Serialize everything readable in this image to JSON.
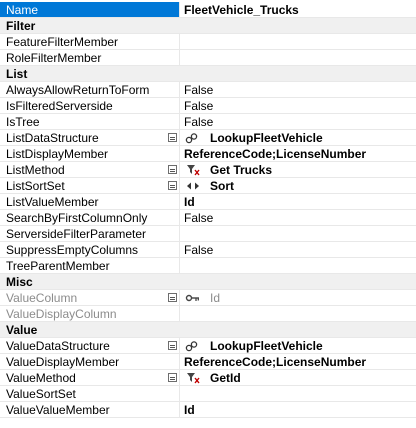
{
  "rows": [
    {
      "kind": "prop",
      "label": "Name",
      "value": "FleetVehicle_Trucks",
      "bold": true,
      "selected": true
    },
    {
      "kind": "cat",
      "label": "Filter"
    },
    {
      "kind": "prop",
      "label": "FeatureFilterMember",
      "value": ""
    },
    {
      "kind": "prop",
      "label": "RoleFilterMember",
      "value": ""
    },
    {
      "kind": "cat",
      "label": "List"
    },
    {
      "kind": "prop",
      "label": "AlwaysAllowReturnToForm",
      "value": "False"
    },
    {
      "kind": "prop",
      "label": "IsFilteredServerside",
      "value": "False"
    },
    {
      "kind": "prop",
      "label": "IsTree",
      "value": "False"
    },
    {
      "kind": "prop",
      "label": "ListDataStructure",
      "value": "LookupFleetVehicle",
      "bold": true,
      "icon": "link-icon",
      "expandable": true
    },
    {
      "kind": "prop",
      "label": "ListDisplayMember",
      "value": "ReferenceCode;LicenseNumber",
      "bold": true
    },
    {
      "kind": "prop",
      "label": "ListMethod",
      "value": "Get Trucks",
      "bold": true,
      "icon": "filter-method-icon",
      "expandable": true
    },
    {
      "kind": "prop",
      "label": "ListSortSet",
      "value": "Sort",
      "bold": true,
      "icon": "sort-icon",
      "expandable": true
    },
    {
      "kind": "prop",
      "label": "ListValueMember",
      "value": "Id",
      "bold": true
    },
    {
      "kind": "prop",
      "label": "SearchByFirstColumnOnly",
      "value": "False"
    },
    {
      "kind": "prop",
      "label": "ServersideFilterParameter",
      "value": ""
    },
    {
      "kind": "prop",
      "label": "SuppressEmptyColumns",
      "value": "False"
    },
    {
      "kind": "prop",
      "label": "TreeParentMember",
      "value": ""
    },
    {
      "kind": "cat",
      "label": "Misc"
    },
    {
      "kind": "prop",
      "label": "ValueColumn",
      "value": "Id",
      "disabled": true,
      "icon": "key-icon",
      "expandable": true
    },
    {
      "kind": "prop",
      "label": "ValueDisplayColumn",
      "value": "",
      "disabled": true
    },
    {
      "kind": "cat",
      "label": "Value"
    },
    {
      "kind": "prop",
      "label": "ValueDataStructure",
      "value": "LookupFleetVehicle",
      "bold": true,
      "icon": "link-icon",
      "expandable": true
    },
    {
      "kind": "prop",
      "label": "ValueDisplayMember",
      "value": "ReferenceCode;LicenseNumber",
      "bold": true
    },
    {
      "kind": "prop",
      "label": "ValueMethod",
      "value": "GetId",
      "bold": true,
      "icon": "filter-method-icon",
      "expandable": true
    },
    {
      "kind": "prop",
      "label": "ValueSortSet",
      "value": ""
    },
    {
      "kind": "prop",
      "label": "ValueValueMember",
      "value": "Id",
      "bold": true
    }
  ]
}
